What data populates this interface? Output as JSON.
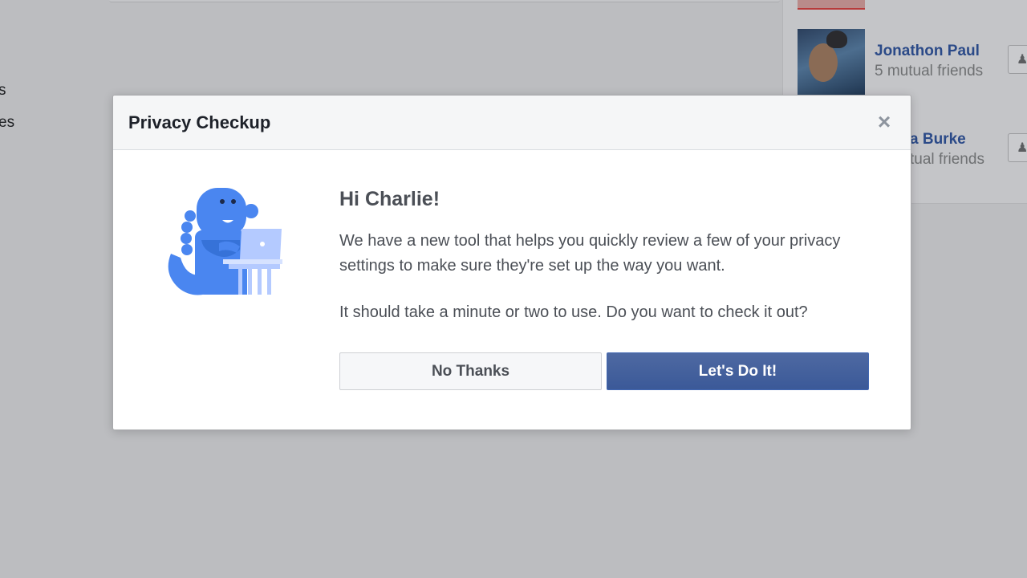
{
  "background": {
    "left_nav": [
      "s",
      "es"
    ],
    "suggestions": [
      {
        "name": "Jonathon Paul",
        "mutual": "5 mutual friends"
      },
      {
        "name": "a Burke",
        "mutual": "tual friends"
      }
    ]
  },
  "modal": {
    "title": "Privacy Checkup",
    "close_icon": "×",
    "greeting": "Hi Charlie!",
    "paragraph1": "We have a new tool that helps you quickly review a few of your privacy settings to make sure they're set up the way you want.",
    "paragraph2": "It should take a minute or two to use. Do you want to check it out?",
    "no_thanks_label": "No Thanks",
    "lets_do_it_label": "Let's Do It!"
  },
  "colors": {
    "primary": "#4267b2",
    "illustration_blue": "#4a86f0",
    "illustration_light": "#b4caff"
  }
}
